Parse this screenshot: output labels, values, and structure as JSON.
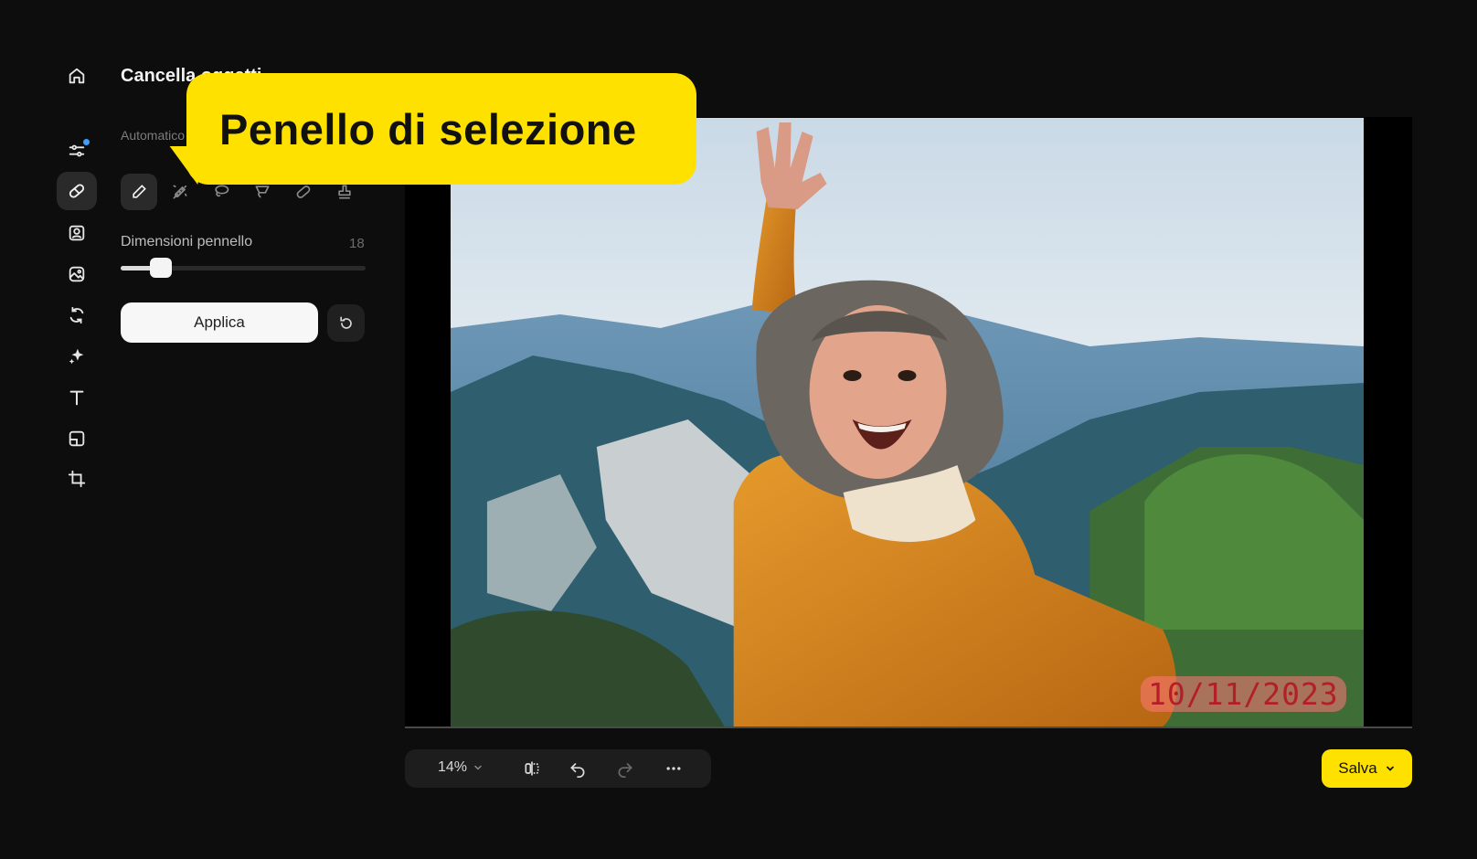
{
  "panel": {
    "title": "Cancella oggetti",
    "mode_label": "Automatico",
    "size_label": "Dimensioni pennello",
    "size_value": "18",
    "slider_fraction": 0.12,
    "apply_label": "Applica"
  },
  "rail": {
    "items": [
      {
        "name": "home-icon",
        "active": false
      },
      {
        "name": "adjust-icon",
        "active": false,
        "badge": true
      },
      {
        "name": "eraser-icon",
        "active": true
      },
      {
        "name": "portrait-icon",
        "active": false
      },
      {
        "name": "gallery-icon",
        "active": false
      },
      {
        "name": "rotate-icon",
        "active": false
      },
      {
        "name": "sparkle-icon",
        "active": false
      },
      {
        "name": "text-icon",
        "active": false
      },
      {
        "name": "layout-icon",
        "active": false
      },
      {
        "name": "crop-icon",
        "active": false
      }
    ],
    "badge_color": "#3aa0ff"
  },
  "tools": [
    {
      "name": "brush-tool-icon",
      "active": true
    },
    {
      "name": "magic-brush-tool-icon",
      "active": false
    },
    {
      "name": "lasso-tool-icon",
      "active": false
    },
    {
      "name": "polygon-lasso-tool-icon",
      "active": false
    },
    {
      "name": "eraser-tool-icon",
      "active": false
    },
    {
      "name": "stamp-tool-icon",
      "active": false
    }
  ],
  "callout": {
    "text": "Penello di selezione",
    "color": "#ffe100"
  },
  "photo": {
    "date_stamp": "10/11/2023"
  },
  "toolbar": {
    "zoom": "14%"
  },
  "save": {
    "label": "Salva",
    "color": "#ffe100"
  }
}
